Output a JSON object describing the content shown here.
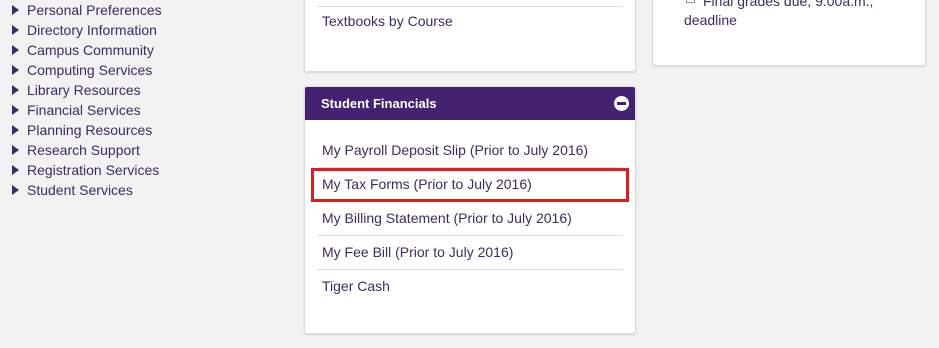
{
  "leftnav": {
    "items": [
      {
        "label": "Personal Preferences"
      },
      {
        "label": "Directory Information"
      },
      {
        "label": "Campus Community"
      },
      {
        "label": "Computing Services"
      },
      {
        "label": "Library Resources"
      },
      {
        "label": "Financial Services"
      },
      {
        "label": "Planning Resources"
      },
      {
        "label": "Research Support"
      },
      {
        "label": "Registration Services"
      },
      {
        "label": "Student Services"
      }
    ]
  },
  "textbooks_card": {
    "link": "Textbooks by Course"
  },
  "announcement_card": {
    "line1": "Final grades due, 9:00a.m.,",
    "line2": "deadline"
  },
  "financials": {
    "title": "Student Financials",
    "collapse_icon": "minus-circle-icon",
    "links": [
      {
        "label": "My Payroll Deposit Slip (Prior to July 2016)"
      },
      {
        "label": "My Tax Forms (Prior to July 2016)",
        "highlighted": true
      },
      {
        "label": "My Billing Statement (Prior to July 2016)"
      },
      {
        "label": "My Fee Bill (Prior to July 2016)"
      },
      {
        "label": "Tiger Cash"
      }
    ]
  },
  "colors": {
    "header_purple": "#432270",
    "link_text": "#3d2b63",
    "highlight_red": "#e11b22"
  }
}
